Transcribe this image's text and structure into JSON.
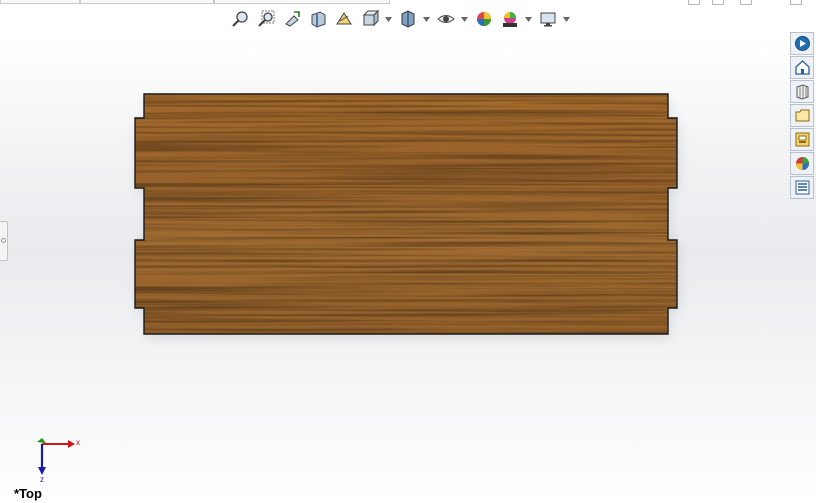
{
  "hud_toolbar": {
    "buttons": [
      {
        "name": "zoom-to-fit-icon"
      },
      {
        "name": "zoom-to-area-icon"
      },
      {
        "name": "previous-view-icon"
      },
      {
        "name": "section-view-icon"
      },
      {
        "name": "dynamic-annotation-views-icon"
      },
      {
        "name": "view-orientation-icon",
        "dropdown": true
      },
      {
        "name": "display-style-icon",
        "dropdown": true
      },
      {
        "name": "hide-show-items-icon",
        "dropdown": true
      },
      {
        "name": "edit-appearance-icon"
      },
      {
        "name": "apply-scene-icon",
        "dropdown": true
      },
      {
        "name": "view-settings-icon",
        "dropdown": true
      }
    ]
  },
  "task_pane": {
    "tabs": [
      {
        "name": "solidworks-resources-icon",
        "color": "#1f6fb3"
      },
      {
        "name": "design-library-icon",
        "color": "#2a5d9a"
      },
      {
        "name": "file-explorer-icon",
        "color": "#555555"
      },
      {
        "name": "view-palette-icon",
        "color": "#b8860b"
      },
      {
        "name": "appearances-scenes-icon",
        "color": "#d23b3b"
      },
      {
        "name": "custom-properties-icon",
        "color": "#2a5d9a"
      }
    ]
  },
  "model": {
    "material": "oak-wood",
    "base_color": "#9a6428",
    "outline_color": "#1a1a1a"
  },
  "triad": {
    "x_label": "x",
    "z_label": "z",
    "x_color": "#d01818",
    "z_color": "#1a1aa8",
    "y_color": "#1a9a1a"
  },
  "view": {
    "label": "*Top"
  }
}
